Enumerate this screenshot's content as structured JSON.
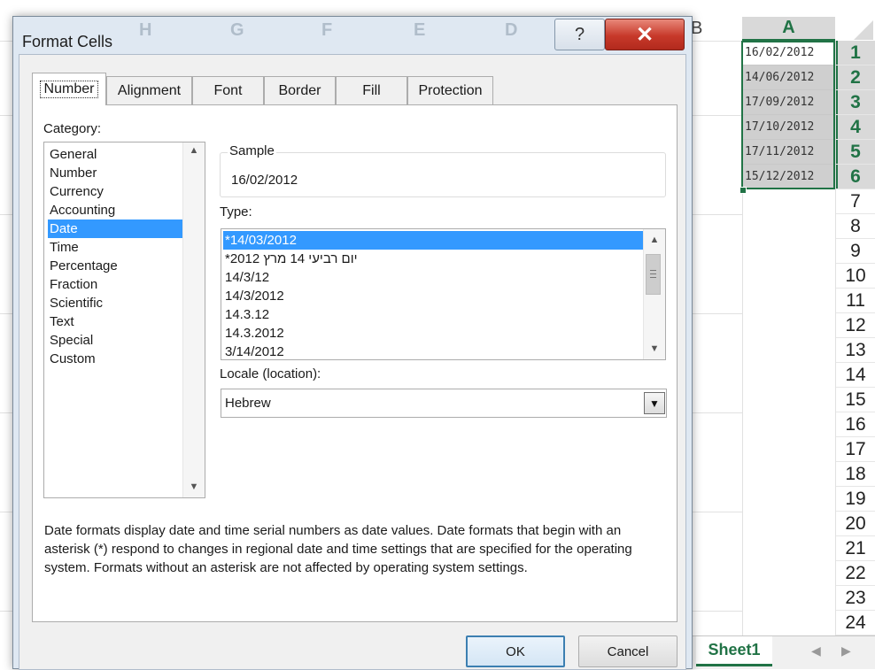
{
  "spreadsheet": {
    "column_a": "A",
    "column_b": "B",
    "ghost_columns": [
      "H",
      "G",
      "F",
      "E",
      "D"
    ],
    "cells_a": [
      "16/02/2012",
      "14/06/2012",
      "17/09/2012",
      "17/10/2012",
      "17/11/2012",
      "15/12/2012"
    ],
    "row_numbers": [
      "1",
      "2",
      "3",
      "4",
      "5",
      "6",
      "7",
      "8",
      "9",
      "10",
      "11",
      "12",
      "13",
      "14",
      "15",
      "16",
      "17",
      "18",
      "19",
      "20",
      "21",
      "22",
      "23",
      "24"
    ],
    "sheet_tab": "Sheet1"
  },
  "dialog": {
    "title": "Format Cells",
    "help_label": "?",
    "close_label": "✕",
    "tabs": [
      "Number",
      "Alignment",
      "Font",
      "Border",
      "Fill",
      "Protection"
    ],
    "category_label": "Category:",
    "categories": [
      "General",
      "Number",
      "Currency",
      "Accounting",
      "Date",
      "Time",
      "Percentage",
      "Fraction",
      "Scientific",
      "Text",
      "Special",
      "Custom"
    ],
    "selected_category": "Date",
    "sample_label": "Sample",
    "sample_value": "16/02/2012",
    "type_label": "Type:",
    "types": [
      "*14/03/2012",
      "*יום רביעי 14 מרץ 2012",
      "14/3/12",
      "14/3/2012",
      "14.3.12",
      "14.3.2012",
      "3/14/2012"
    ],
    "selected_type_index": 0,
    "locale_label": "Locale (location):",
    "locale_value": "Hebrew",
    "description": "Date formats display date and time serial numbers as date values.  Date formats that begin with an asterisk (*) respond to changes in regional date and time settings that are specified for the operating system. Formats without an asterisk are not affected by operating system settings.",
    "ok_label": "OK",
    "cancel_label": "Cancel"
  },
  "colors": {
    "excel_green": "#217346",
    "selection_blue": "#3399ff",
    "close_red": "#c7392a"
  }
}
